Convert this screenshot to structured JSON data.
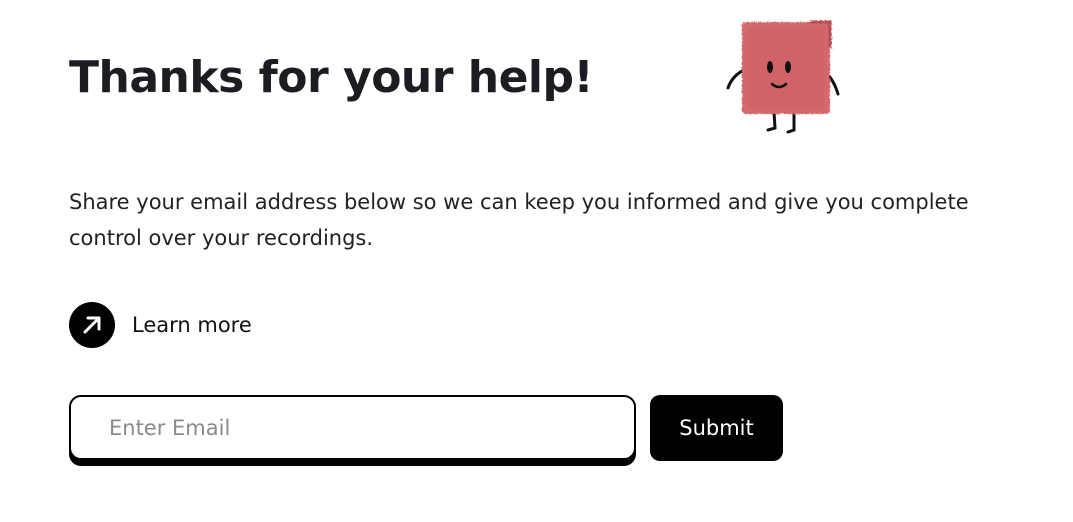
{
  "header": {
    "title": "Thanks for your help!",
    "mascot_icon": "smiling-pink-cube-mascot"
  },
  "main": {
    "description": "Share your email address below so we can keep you informed and give you complete control over your recordings.",
    "learn_more": {
      "label": "Learn more",
      "icon": "arrow-up-right-icon"
    }
  },
  "form": {
    "email": {
      "placeholder": "Enter Email",
      "value": ""
    },
    "submit_label": "Submit"
  },
  "colors": {
    "text": "#1c1c22",
    "button_bg": "#000000",
    "button_text": "#ffffff",
    "placeholder": "#8a8a8a",
    "mascot": "#d4686c"
  }
}
